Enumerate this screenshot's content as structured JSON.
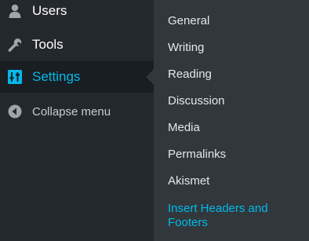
{
  "menu": {
    "items": [
      {
        "label": "Users",
        "icon": "users-icon"
      },
      {
        "label": "Tools",
        "icon": "wrench-icon"
      },
      {
        "label": "Settings",
        "icon": "settings-sliders-icon",
        "active": true
      },
      {
        "label": "Collapse menu",
        "icon": "collapse-arrow-icon"
      }
    ]
  },
  "submenu": {
    "items": [
      {
        "label": "General"
      },
      {
        "label": "Writing"
      },
      {
        "label": "Reading"
      },
      {
        "label": "Discussion"
      },
      {
        "label": "Media"
      },
      {
        "label": "Permalinks"
      },
      {
        "label": "Akismet"
      },
      {
        "label": "Insert Headers and Footers",
        "current": true
      }
    ]
  },
  "colors": {
    "menu_bg": "#23282d",
    "active_bg": "#191e23",
    "submenu_bg": "#32373c",
    "accent": "#00b9eb",
    "text": "#ffffff"
  }
}
